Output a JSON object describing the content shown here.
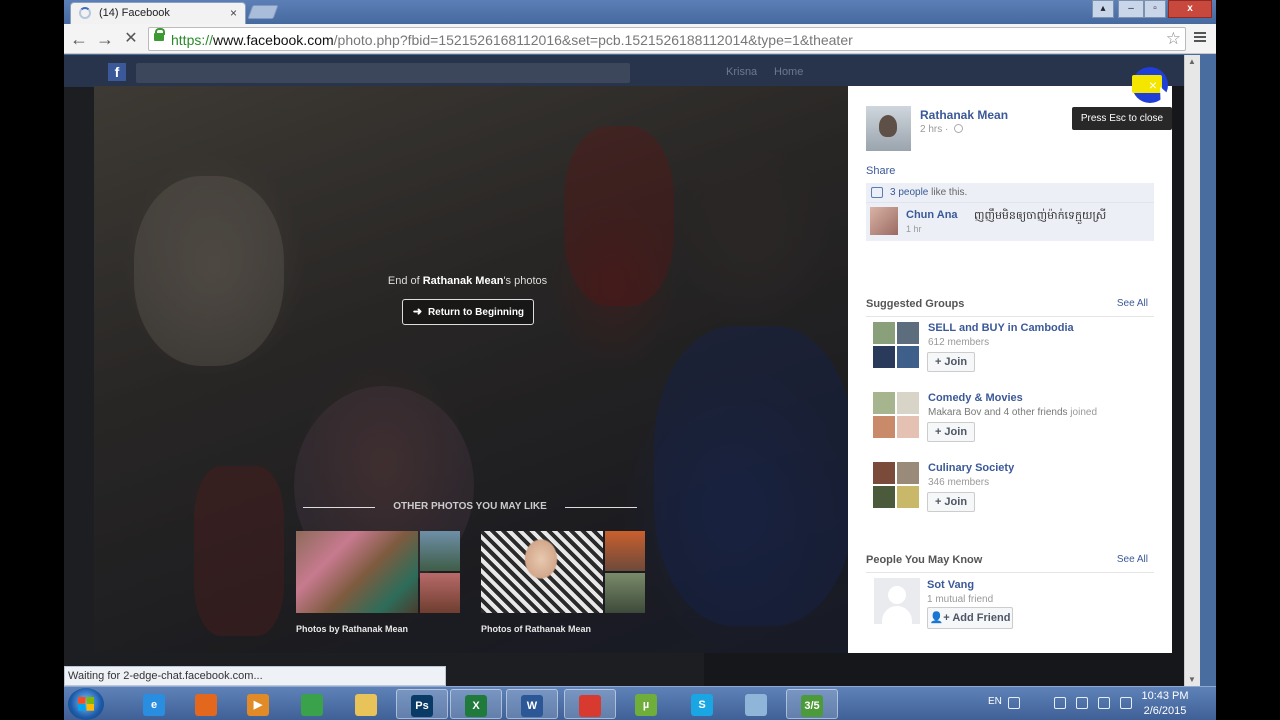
{
  "browser": {
    "tab_title": "(14) Facebook",
    "tab_close": "×",
    "url_scheme": "https://",
    "url_host": "www.facebook.com",
    "url_path": "/photo.php?fbid=1521526168112016&set=pcb.1521526188112014&type=1&theater",
    "status_text": "Waiting for 2-edge-chat.facebook.com...",
    "window_controls": {
      "close": "x",
      "minimize": "–",
      "restore": "▫",
      "extra": "▴"
    },
    "nav": {
      "back": "←",
      "forward": "→",
      "stop": "✕",
      "star": "☆"
    }
  },
  "fb_bar": {
    "logo": "f",
    "links": [
      "Krisna",
      "Home"
    ]
  },
  "viewer": {
    "end_prefix": "End of ",
    "end_owner": "Rathanak Mean",
    "end_suffix": "'s photos",
    "return_button": "Return to Beginning",
    "other_title": "OTHER PHOTOS YOU MAY LIKE",
    "albums": [
      {
        "caption": "Photos by Rathanak Mean"
      },
      {
        "caption": "Photos of Rathanak Mean"
      }
    ]
  },
  "panel": {
    "author": "Rathanak Mean",
    "time": "2 hrs · ",
    "share": "Share",
    "likes_count": "3 people",
    "likes_suffix": " like this.",
    "comment": {
      "name": "Chun Ana",
      "text": "ញញឹមមិនឲ្យចាញ់ម៉ាក់ទេក្មួយស្រី",
      "time": "1 hr"
    },
    "suggested_groups": {
      "title": "Suggested Groups",
      "see_all": "See All",
      "items": [
        {
          "name": "SELL and BUY in Cambodia",
          "meta": "612 members",
          "join": "+ Join"
        },
        {
          "name": "Comedy & Movies",
          "meta_friends": "Makara Bov and 4 other friends",
          "meta_suffix": " joined",
          "join": "+ Join"
        },
        {
          "name": "Culinary Society",
          "meta": "346 members",
          "join": "+ Join"
        }
      ]
    },
    "people": {
      "title": "People You May Know",
      "see_all": "See All",
      "name": "Sot Vang",
      "meta": "1 mutual friend",
      "add_friend": "Add Friend"
    },
    "tooltip": "Press Esc to close",
    "close_icon": "×"
  },
  "taskbar": {
    "apps": [
      {
        "name": "ie",
        "label": "e",
        "color": "#2a8ee0"
      },
      {
        "name": "firefox",
        "label": "",
        "color": "#e3681e"
      },
      {
        "name": "media",
        "label": "▶",
        "color": "#e08a28"
      },
      {
        "name": "globe",
        "label": "",
        "color": "#3aa24a"
      },
      {
        "name": "folder",
        "label": "",
        "color": "#e8c35a"
      },
      {
        "name": "photoshop",
        "label": "Ps",
        "color": "#0a3a66"
      },
      {
        "name": "excel",
        "label": "X",
        "color": "#1f7a3c"
      },
      {
        "name": "word",
        "label": "W",
        "color": "#2b5797"
      },
      {
        "name": "chrome",
        "label": "",
        "color": "#d83a30"
      },
      {
        "name": "utorrent",
        "label": "µ",
        "color": "#6fae3a"
      },
      {
        "name": "skype",
        "label": "S",
        "color": "#1aa6e3"
      },
      {
        "name": "notebook",
        "label": "",
        "color": "#8fb5d9"
      },
      {
        "name": "movie",
        "label": "3/5",
        "color": "#4d9a3a"
      }
    ],
    "lang": "EN",
    "time": "10:43 PM",
    "date": "2/6/2015"
  }
}
